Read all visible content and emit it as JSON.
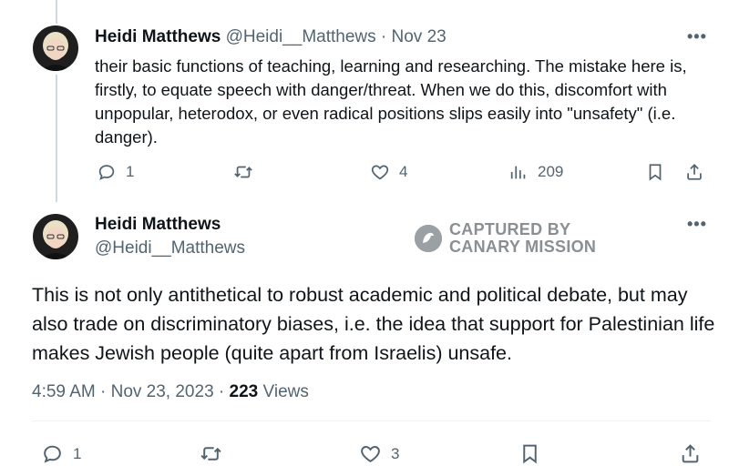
{
  "tweet1": {
    "author_name": "Heidi Matthews",
    "author_handle": "@Heidi__Matthews",
    "separator": "·",
    "date": "Nov 23",
    "more": "•••",
    "body": "their basic functions of teaching, learning and researching. The mistake here is, firstly, to equate speech with danger/threat. When we do this, discomfort with unpopular, heterodox, or even radical positions slips easily into \"unsafety\" (i.e. danger).",
    "replies": "1",
    "retweets": "",
    "likes": "4",
    "views": "209"
  },
  "tweet2": {
    "author_name": "Heidi Matthews",
    "author_handle": "@Heidi__Matthews",
    "more": "•••",
    "body": "This is not only antithetical to robust academic and political debate, but may also trade on discriminatory biases, i.e. the idea that support for Palestinian life makes Jewish people (quite apart from Israelis) unsafe.",
    "time": "4:59 AM",
    "date": "Nov 23, 2023",
    "separator": "·",
    "views_count": "223",
    "views_label": "Views",
    "replies": "1",
    "retweets": "",
    "likes": "3"
  },
  "watermark": {
    "line1": "CAPTURED BY",
    "line2": "CANARY MISSION"
  },
  "icons": {
    "reply": "reply-icon",
    "retweet": "retweet-icon",
    "like": "heart-icon",
    "views": "views-icon",
    "bookmark": "bookmark-icon",
    "share": "share-icon"
  }
}
